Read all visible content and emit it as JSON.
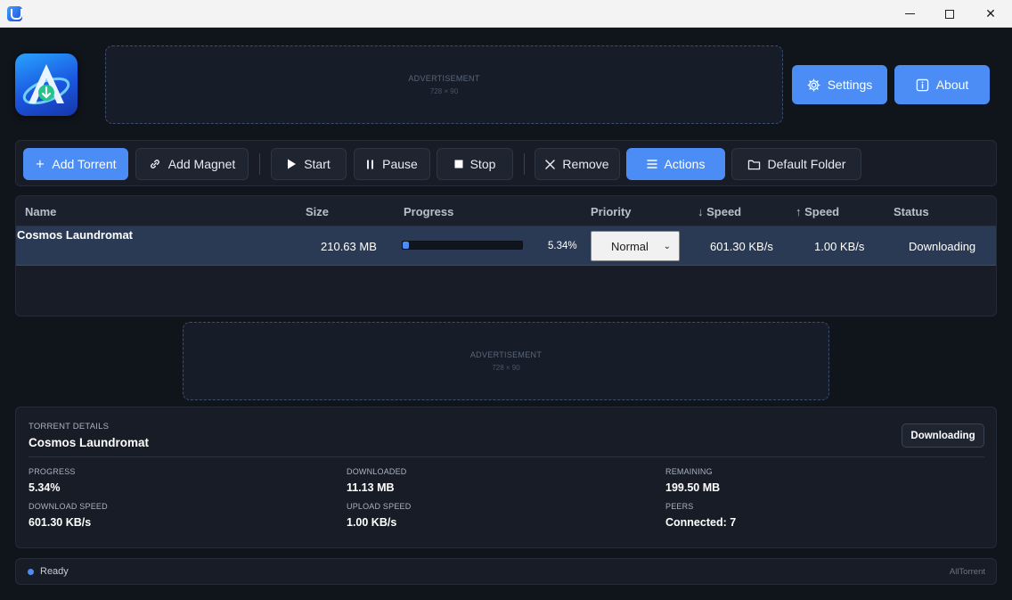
{
  "window": {
    "minimize_glyph": "",
    "close_glyph": "✕"
  },
  "header": {
    "ad_top": {
      "label": "ADVERTISEMENT",
      "size": "728 × 90"
    },
    "settings_label": "Settings",
    "about_label": "About",
    "logo_icon": "alltorrent-logo"
  },
  "toolbar": {
    "add_torrent": "Add Torrent",
    "add_magnet": "Add Magnet",
    "start": "Start",
    "pause": "Pause",
    "stop": "Stop",
    "remove": "Remove",
    "actions": "Actions",
    "default_folder": "Default Folder"
  },
  "table": {
    "columns": {
      "name": "Name",
      "size": "Size",
      "progress": "Progress",
      "priority": "Priority",
      "down_speed": "↓ Speed",
      "up_speed": "↑ Speed",
      "status": "Status"
    },
    "rows": [
      {
        "name": "Cosmos Laundromat",
        "size": "210.63 MB",
        "progress": 0.0534,
        "progress_text": "5.34%",
        "priority": "Normal",
        "down_speed": "601.30 KB/s",
        "up_speed": "1.00 KB/s",
        "status": "Downloading"
      }
    ]
  },
  "ad_middle": {
    "label": "ADVERTISEMENT",
    "size": "728 × 90"
  },
  "details": {
    "caption": "TORRENT DETAILS",
    "name": "Cosmos Laundromat",
    "status": "Downloading",
    "progress_label": "PROGRESS",
    "progress_value": "5.34%",
    "downloaded_label": "DOWNLOADED",
    "downloaded_value": "11.13 MB",
    "remaining_label": "REMAINING",
    "remaining_value": "199.50 MB",
    "download_speed_label": "DOWNLOAD SPEED",
    "download_speed_value": "601.30 KB/s",
    "upload_speed_label": "UPLOAD SPEED",
    "upload_speed_value": "1.00 KB/s",
    "peers_label": "PEERS",
    "peers_value": "Connected: 7"
  },
  "statusbar": {
    "text": "Ready",
    "brand": "AllTorrent"
  },
  "colors": {
    "accent": "#4b8df5",
    "background": "#10141b",
    "panel": "#171c26",
    "selected_row": "#2a3a55"
  }
}
